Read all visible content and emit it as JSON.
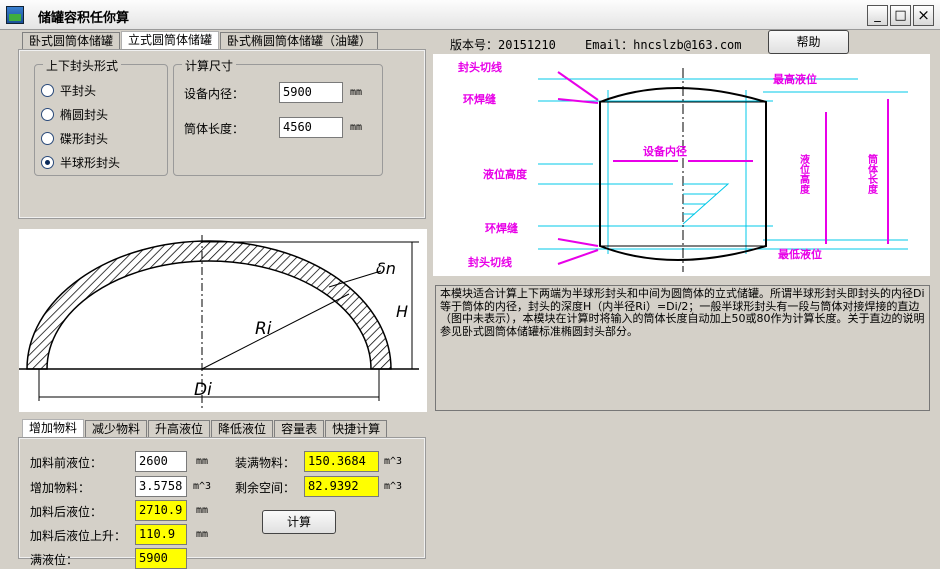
{
  "window": {
    "title": "储罐容积任你算",
    "min": "_",
    "max": "□",
    "close": "×"
  },
  "top_tabs": [
    "卧式圆筒体储罐",
    "立式圆筒体储罐",
    "卧式椭圆筒体储罐（油罐）"
  ],
  "head_group": {
    "title": "上下封头形式",
    "options": [
      "平封头",
      "椭圆封头",
      "碟形封头",
      "半球形封头"
    ],
    "selected_index": 3
  },
  "size_group": {
    "title": "计算尺寸",
    "diameter_label": "设备内径：",
    "diameter_value": "5900",
    "diameter_unit": "mm",
    "length_label": "筒体长度：",
    "length_value": "4560",
    "length_unit": "mm"
  },
  "info": {
    "version": "版本号：20151210",
    "email": "Email：hncslzb@163.com",
    "help": "帮助"
  },
  "tank_diagram": {
    "top_seam": "封头切线",
    "max_level": "最高液位",
    "ring_weld_top": "环焊缝",
    "inner_diameter": "设备内径",
    "liquid_level": "液位高度",
    "ring_weld_bottom": "环焊缝",
    "bottom_seam": "封头切线",
    "min_level": "最低液位",
    "left_vertical": "液位高度",
    "right_vertical": "筒体长度"
  },
  "head_diagram": {
    "delta": "δn",
    "H": "H",
    "R": "Ri",
    "D": "Di"
  },
  "description": "本模块适合计算上下两端为半球形封头和中间为圆筒体的立式储罐。所谓半球形封头即封头的内径Di等于筒体的内径，封头的深度H（内半径Ri）=Di/2；一般半球形封头有一段与筒体对接焊接的直边（图中未表示），本模块在计算时将输入的筒体长度自动加上50或80作为计算长度。关于直边的说明参见卧式圆筒体储罐标准椭圆封头部分。",
  "calc_tabs": [
    "增加物料",
    "减少物料",
    "升高液位",
    "降低液位",
    "容量表",
    "快捷计算"
  ],
  "calc": {
    "before_label": "加料前液位：",
    "before_value": "2600",
    "before_unit": "mm",
    "add_label": "增加物料：",
    "add_value": "3.5758",
    "add_unit": "m^3",
    "after_label": "加料后液位：",
    "after_value": "2710.9",
    "after_unit": "mm",
    "rise_label": "加料后液位上升：",
    "rise_value": "110.9",
    "rise_unit": "mm",
    "full_label": "装满物料：",
    "full_value": "150.3684",
    "full_unit": "m^3",
    "remain_label": "剩余空间：",
    "remain_value": "82.9392",
    "remain_unit": "m^3",
    "calc_button": "计算",
    "cut_label": "满液位：",
    "cut_value": "5900"
  },
  "colors": {
    "magenta": "#e800e8",
    "cyan": "#00c8e8",
    "yellow": "#ffff00"
  }
}
